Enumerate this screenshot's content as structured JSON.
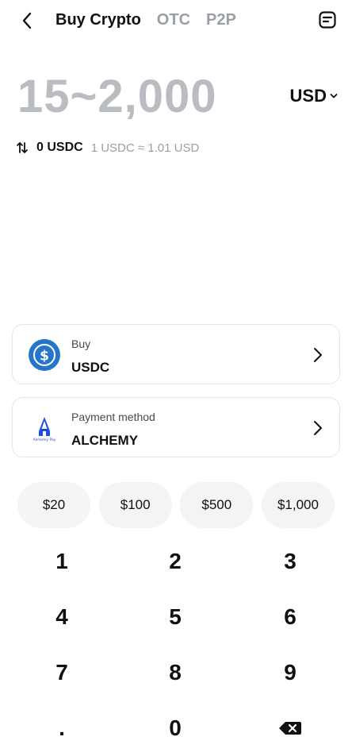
{
  "nav": {
    "tabs": [
      {
        "label": "Buy Crypto",
        "active": true
      },
      {
        "label": "OTC",
        "active": false
      },
      {
        "label": "P2P",
        "active": false
      }
    ],
    "back_icon": "chevron-left-icon",
    "orders_icon": "orders-icon"
  },
  "amount": {
    "range": "15~2,000",
    "currency": "USD"
  },
  "conversion": {
    "amount": "0 USDC",
    "rate": "1 USDC ≈ 1.01 USD"
  },
  "buy_card": {
    "sub": "Buy",
    "value": "USDC"
  },
  "payment_card": {
    "sub": "Payment method",
    "value": "ALCHEMY",
    "logo_text": "Alchemy Pay"
  },
  "presets": [
    "$20",
    "$100",
    "$500",
    "$1,000"
  ],
  "keypad": [
    "1",
    "2",
    "3",
    "4",
    "5",
    "6",
    "7",
    "8",
    "9",
    ".",
    "0"
  ],
  "colors": {
    "accent_blue": "#2775CA",
    "muted": "#B9BCC0",
    "text": "#111111"
  }
}
